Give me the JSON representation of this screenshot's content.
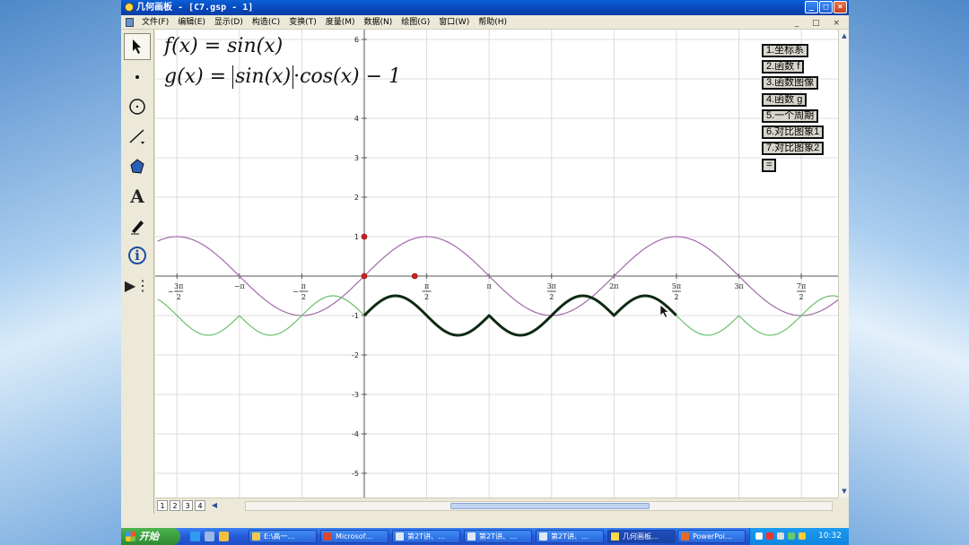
{
  "window": {
    "title": "几何画板 - [C7.gsp - 1]",
    "buttons": {
      "minimize": "_",
      "maximize": "□",
      "close": "×"
    }
  },
  "menu": {
    "items": [
      "文件(F)",
      "编辑(E)",
      "显示(D)",
      "构造(C)",
      "变换(T)",
      "度量(M)",
      "数据(N)",
      "绘图(G)",
      "窗口(W)",
      "帮助(H)"
    ],
    "mdi_buttons": "_ □ ×"
  },
  "toolbox": {
    "tools": [
      "arrow-select-icon",
      "point-icon",
      "compass-icon",
      "straightedge-icon",
      "polygon-icon",
      "text-tool-icon",
      "marker-pen-icon",
      "info-icon",
      "custom-tools-icon"
    ],
    "glyphs": {
      "text": "A",
      "info": "i",
      "custom": "▶⋮"
    }
  },
  "formulas": {
    "f": "f(x) = sin(x)",
    "g_prefix": "g(x) = ",
    "g_abs": "sin(x)",
    "g_suffix": "·cos(x) − 1"
  },
  "action_buttons": [
    "1.坐标系",
    "2.函数 f",
    "3.函数图像",
    "4.函数 g",
    "5.一个周期",
    "6.对比图象1",
    "7.对比图象2",
    "="
  ],
  "axes": {
    "y_ticks": [
      "6",
      "4",
      "3",
      "2",
      "1",
      "-1",
      "-2",
      "-3",
      "-4",
      "-5"
    ],
    "x_ticks": [
      {
        "sign": "−",
        "num": "3π",
        "den": "2"
      },
      {
        "sign": "",
        "num": "−π",
        "den": ""
      },
      {
        "sign": "−",
        "num": "π",
        "den": "2"
      },
      {
        "sign": "",
        "num": "π",
        "den": "2"
      },
      {
        "sign": "",
        "num": "π",
        "den": ""
      },
      {
        "sign": "",
        "num": "3π",
        "den": "2"
      },
      {
        "sign": "",
        "num": "2π",
        "den": ""
      },
      {
        "sign": "",
        "num": "5π",
        "den": "2"
      },
      {
        "sign": "",
        "num": "3π",
        "den": ""
      },
      {
        "sign": "",
        "num": "7π",
        "den": "2"
      }
    ]
  },
  "colors": {
    "f_curve": "#a06aa8",
    "g_curve": "#6cbf6c",
    "g_trace": "#0d2a12",
    "point": "#d42020"
  },
  "chart_data": {
    "type": "line",
    "title": "",
    "xlabel": "",
    "ylabel": "",
    "xlim": [
      -5.2,
      16.6
    ],
    "ylim": [
      -5.8,
      6.2
    ],
    "grid": true,
    "series": [
      {
        "name": "f(x) = sin(x)",
        "function": "sin(x)",
        "x_range": [
          -5.2,
          16.6
        ],
        "color": "#a06aa8"
      },
      {
        "name": "g(x) = |sin(x)|·cos(x) − 1",
        "function": "abs(sin(x))*cos(x)-1",
        "x_range": [
          -5.2,
          16.6
        ],
        "color": "#6cbf6c"
      },
      {
        "name": "",
        "function": "abs(sin(x))*cos(x)-1",
        "x_range": [
          0,
          7.85
        ],
        "color": "#0d2a12",
        "bold": true
      }
    ],
    "points": [
      [
        0,
        1
      ],
      [
        0,
        0
      ],
      [
        1.27,
        0
      ]
    ]
  },
  "pages": [
    "1",
    "2",
    "3",
    "4"
  ],
  "taskbar": {
    "start": "开始",
    "items": [
      "E:\\高一…",
      "Microsof…",
      "第2T讲、…",
      "第2T讲、…",
      "第2T讲、…",
      "几何画板…",
      "PowerPoi…"
    ],
    "active_index": 5,
    "clock": "10:32"
  }
}
